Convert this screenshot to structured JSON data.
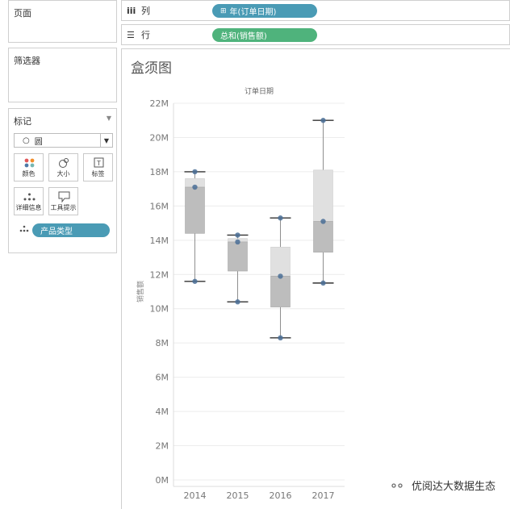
{
  "left": {
    "pages_title": "页面",
    "filters_title": "筛选器",
    "marks_title": "标记",
    "mark_type": "圆",
    "mark_cards": [
      {
        "label": "颜色",
        "icon": "color-icon"
      },
      {
        "label": "大小",
        "icon": "size-icon"
      },
      {
        "label": "标签",
        "icon": "label-icon"
      },
      {
        "label": "详细信息",
        "icon": "detail-icon"
      },
      {
        "label": "工具提示",
        "icon": "tooltip-icon"
      }
    ],
    "detail_field": "产品类型"
  },
  "shelves": {
    "columns_label": "列",
    "columns_pill": "年(订单日期)",
    "rows_label": "行",
    "rows_pill": "总和(销售额)"
  },
  "chart_title": "盒须图",
  "chart_data": {
    "type": "boxplot",
    "title": "",
    "top_header": "订单日期",
    "ylabel": "销售额",
    "ylim": [
      0,
      22
    ],
    "yunit": "M",
    "yticks": [
      "0M",
      "2M",
      "4M",
      "6M",
      "8M",
      "10M",
      "12M",
      "14M",
      "16M",
      "18M",
      "20M",
      "22M"
    ],
    "categories": [
      "2014",
      "2015",
      "2016",
      "2017"
    ],
    "boxes": [
      {
        "min": 11.6,
        "q1": 14.4,
        "median": 17.1,
        "q3": 17.6,
        "max": 18.0,
        "points": [
          11.6,
          17.1,
          18.0
        ]
      },
      {
        "min": 10.4,
        "q1": 12.2,
        "median": 13.9,
        "q3": 14.1,
        "max": 14.3,
        "points": [
          10.4,
          13.9,
          14.3
        ]
      },
      {
        "min": 8.3,
        "q1": 10.1,
        "median": 11.9,
        "q3": 13.6,
        "max": 15.3,
        "points": [
          8.3,
          11.9,
          15.3
        ]
      },
      {
        "min": 11.5,
        "q1": 13.3,
        "median": 15.1,
        "q3": 18.1,
        "max": 21.0,
        "points": [
          11.5,
          15.1,
          21.0
        ]
      }
    ],
    "grid": true,
    "colors": {
      "box_lower": "#bdbdbd",
      "box_upper": "#e0e0e0",
      "point": "#4a6f96",
      "whisker": "#8f8f8f",
      "cap": "#333333"
    }
  },
  "watermark": "优阅达大数据生态"
}
